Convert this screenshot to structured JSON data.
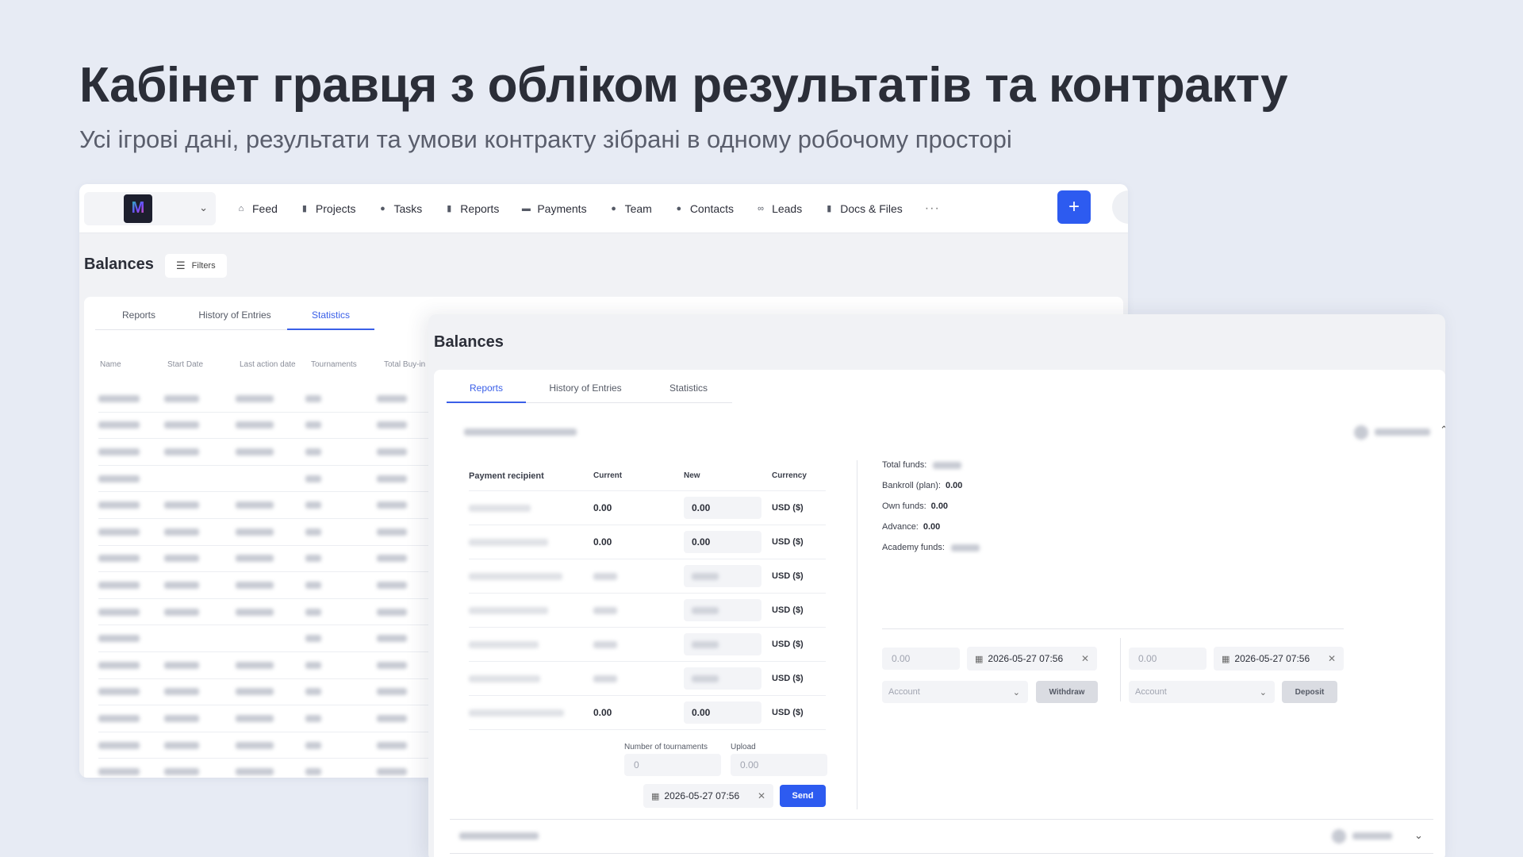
{
  "hero": {
    "title": "Кабінет гравця з обліком результатів та контракту",
    "subtitle": "Усі ігрові дані, результати та умови контракту зібрані в одному робочому просторі"
  },
  "topbar": {
    "logo_letter": "M",
    "nav": [
      {
        "label": "Feed",
        "icon": "home-icon",
        "glyph": "⌂"
      },
      {
        "label": "Projects",
        "icon": "file-icon",
        "glyph": "▮"
      },
      {
        "label": "Tasks",
        "icon": "check-circle-icon",
        "glyph": "●"
      },
      {
        "label": "Reports",
        "icon": "document-icon",
        "glyph": "▮"
      },
      {
        "label": "Payments",
        "icon": "card-icon",
        "glyph": "▬"
      },
      {
        "label": "Team",
        "icon": "person-icon",
        "glyph": "●"
      },
      {
        "label": "Contacts",
        "icon": "contacts-icon",
        "glyph": "●"
      },
      {
        "label": "Leads",
        "icon": "link-icon",
        "glyph": "∞"
      },
      {
        "label": "Docs & Files",
        "icon": "book-icon",
        "glyph": "▮"
      }
    ],
    "more": "···",
    "plus": "+"
  },
  "back": {
    "title": "Balances",
    "filters": "Filters",
    "tabs": [
      "Reports",
      "History of Entries",
      "Statistics"
    ],
    "active_tab": "Statistics",
    "columns": [
      "Name",
      "Start Date",
      "Last action date",
      "Tournaments",
      "Total Buy-in"
    ]
  },
  "front": {
    "title": "Balances",
    "tabs": [
      "Reports",
      "History of Entries",
      "Statistics"
    ],
    "active_tab": "Reports",
    "pay_columns": [
      "Payment recipient",
      "Current",
      "New",
      "Currency"
    ],
    "rows": [
      {
        "current": "0.00",
        "new": "0.00",
        "currency": "USD ($)"
      },
      {
        "current": "0.00",
        "new": "0.00",
        "currency": "USD ($)"
      },
      {
        "current": "",
        "new": "",
        "currency": "USD ($)"
      },
      {
        "current": "",
        "new": "",
        "currency": "USD ($)"
      },
      {
        "current": "",
        "new": "",
        "currency": "USD ($)"
      },
      {
        "current": "",
        "new": "",
        "currency": "USD ($)"
      },
      {
        "current": "0.00",
        "new": "0.00",
        "currency": "USD ($)"
      }
    ],
    "num_tournaments_label": "Number of tournaments",
    "num_tournaments_placeholder": "0",
    "upload_label": "Upload",
    "upload_placeholder": "0.00",
    "date": "2026-05-27 07:56",
    "send": "Send",
    "funds": {
      "total_label": "Total funds:",
      "bankroll_label": "Bankroll (plan):",
      "bankroll_value": "0.00",
      "own_label": "Own funds:",
      "own_value": "0.00",
      "advance_label": "Advance:",
      "advance_value": "0.00",
      "academy_label": "Academy funds:"
    },
    "withdraw": {
      "amount_placeholder": "0.00",
      "date": "2026-05-27 07:56",
      "account_placeholder": "Account",
      "button": "Withdraw"
    },
    "deposit": {
      "amount_placeholder": "0.00",
      "date": "2026-05-27 07:56",
      "account_placeholder": "Account",
      "button": "Deposit"
    }
  }
}
